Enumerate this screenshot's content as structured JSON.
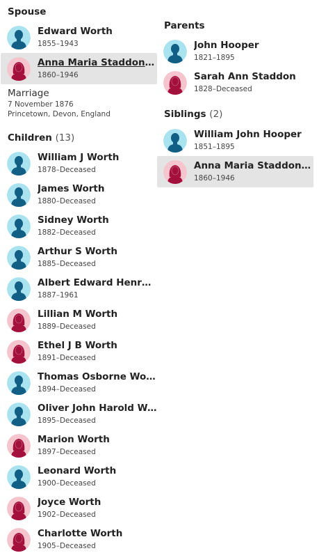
{
  "colors": {
    "male_bg": "#a9e3f0",
    "male_fg": "#125f86",
    "female_bg": "#f6c4cd",
    "female_fg": "#a4103c",
    "selected_bg": "#e4e4e4"
  },
  "spouse": {
    "title": "Spouse",
    "people": [
      {
        "name": "Edward Worth",
        "dates": "1855–1943",
        "gender": "male"
      },
      {
        "name": "Anna Maria Staddon H...",
        "dates": "1860–1946",
        "gender": "female"
      }
    ]
  },
  "marriage": {
    "label": "Marriage",
    "date": "7 November 1876",
    "place": "Princetown, Devon, England"
  },
  "children": {
    "title": "Children",
    "count": "(13)",
    "people": [
      {
        "name": "William J Worth",
        "dates": "1878–Deceased",
        "gender": "male"
      },
      {
        "name": "James Worth",
        "dates": "1880–Deceased",
        "gender": "male"
      },
      {
        "name": "Sidney Worth",
        "dates": "1882–Deceased",
        "gender": "male"
      },
      {
        "name": "Arthur S Worth",
        "dates": "1885–Deceased",
        "gender": "male"
      },
      {
        "name": "Albert Edward Henry ...",
        "dates": "1887–1961",
        "gender": "male"
      },
      {
        "name": "Lillian M Worth",
        "dates": "1889–Deceased",
        "gender": "female"
      },
      {
        "name": "Ethel J B Worth",
        "dates": "1891–Deceased",
        "gender": "female"
      },
      {
        "name": "Thomas Osborne Worth",
        "dates": "1894–Deceased",
        "gender": "male"
      },
      {
        "name": "Oliver John Harold Wor...",
        "dates": "1895–Deceased",
        "gender": "male"
      },
      {
        "name": "Marion Worth",
        "dates": "1897–Deceased",
        "gender": "female"
      },
      {
        "name": "Leonard Worth",
        "dates": "1900–Deceased",
        "gender": "male"
      },
      {
        "name": "Joyce Worth",
        "dates": "1902–Deceased",
        "gender": "female"
      },
      {
        "name": "Charlotte Worth",
        "dates": "1905–Deceased",
        "gender": "female"
      }
    ]
  },
  "parents": {
    "title": "Parents",
    "people": [
      {
        "name": "John Hooper",
        "dates": "1821–1895",
        "gender": "male"
      },
      {
        "name": "Sarah Ann Staddon",
        "dates": "1828–Deceased",
        "gender": "female"
      }
    ]
  },
  "siblings": {
    "title": "Siblings",
    "count": "(2)",
    "people": [
      {
        "name": "William John Hooper",
        "dates": "1851–1895",
        "gender": "male"
      },
      {
        "name": "Anna Maria Staddon H...",
        "dates": "1860–1946",
        "gender": "female"
      }
    ]
  }
}
